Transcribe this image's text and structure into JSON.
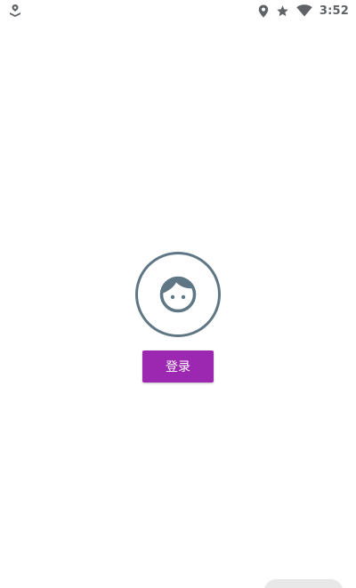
{
  "status_bar": {
    "time": "3:52",
    "icons": [
      "app-notification-icon",
      "location-icon",
      "star-icon",
      "wifi-icon"
    ]
  },
  "main": {
    "avatar_icon": "user-face-icon",
    "login_label": "登录"
  },
  "colors": {
    "accent": "#9c27b0",
    "avatar_stroke": "#5f7785",
    "status_icons": "#5f6368"
  }
}
